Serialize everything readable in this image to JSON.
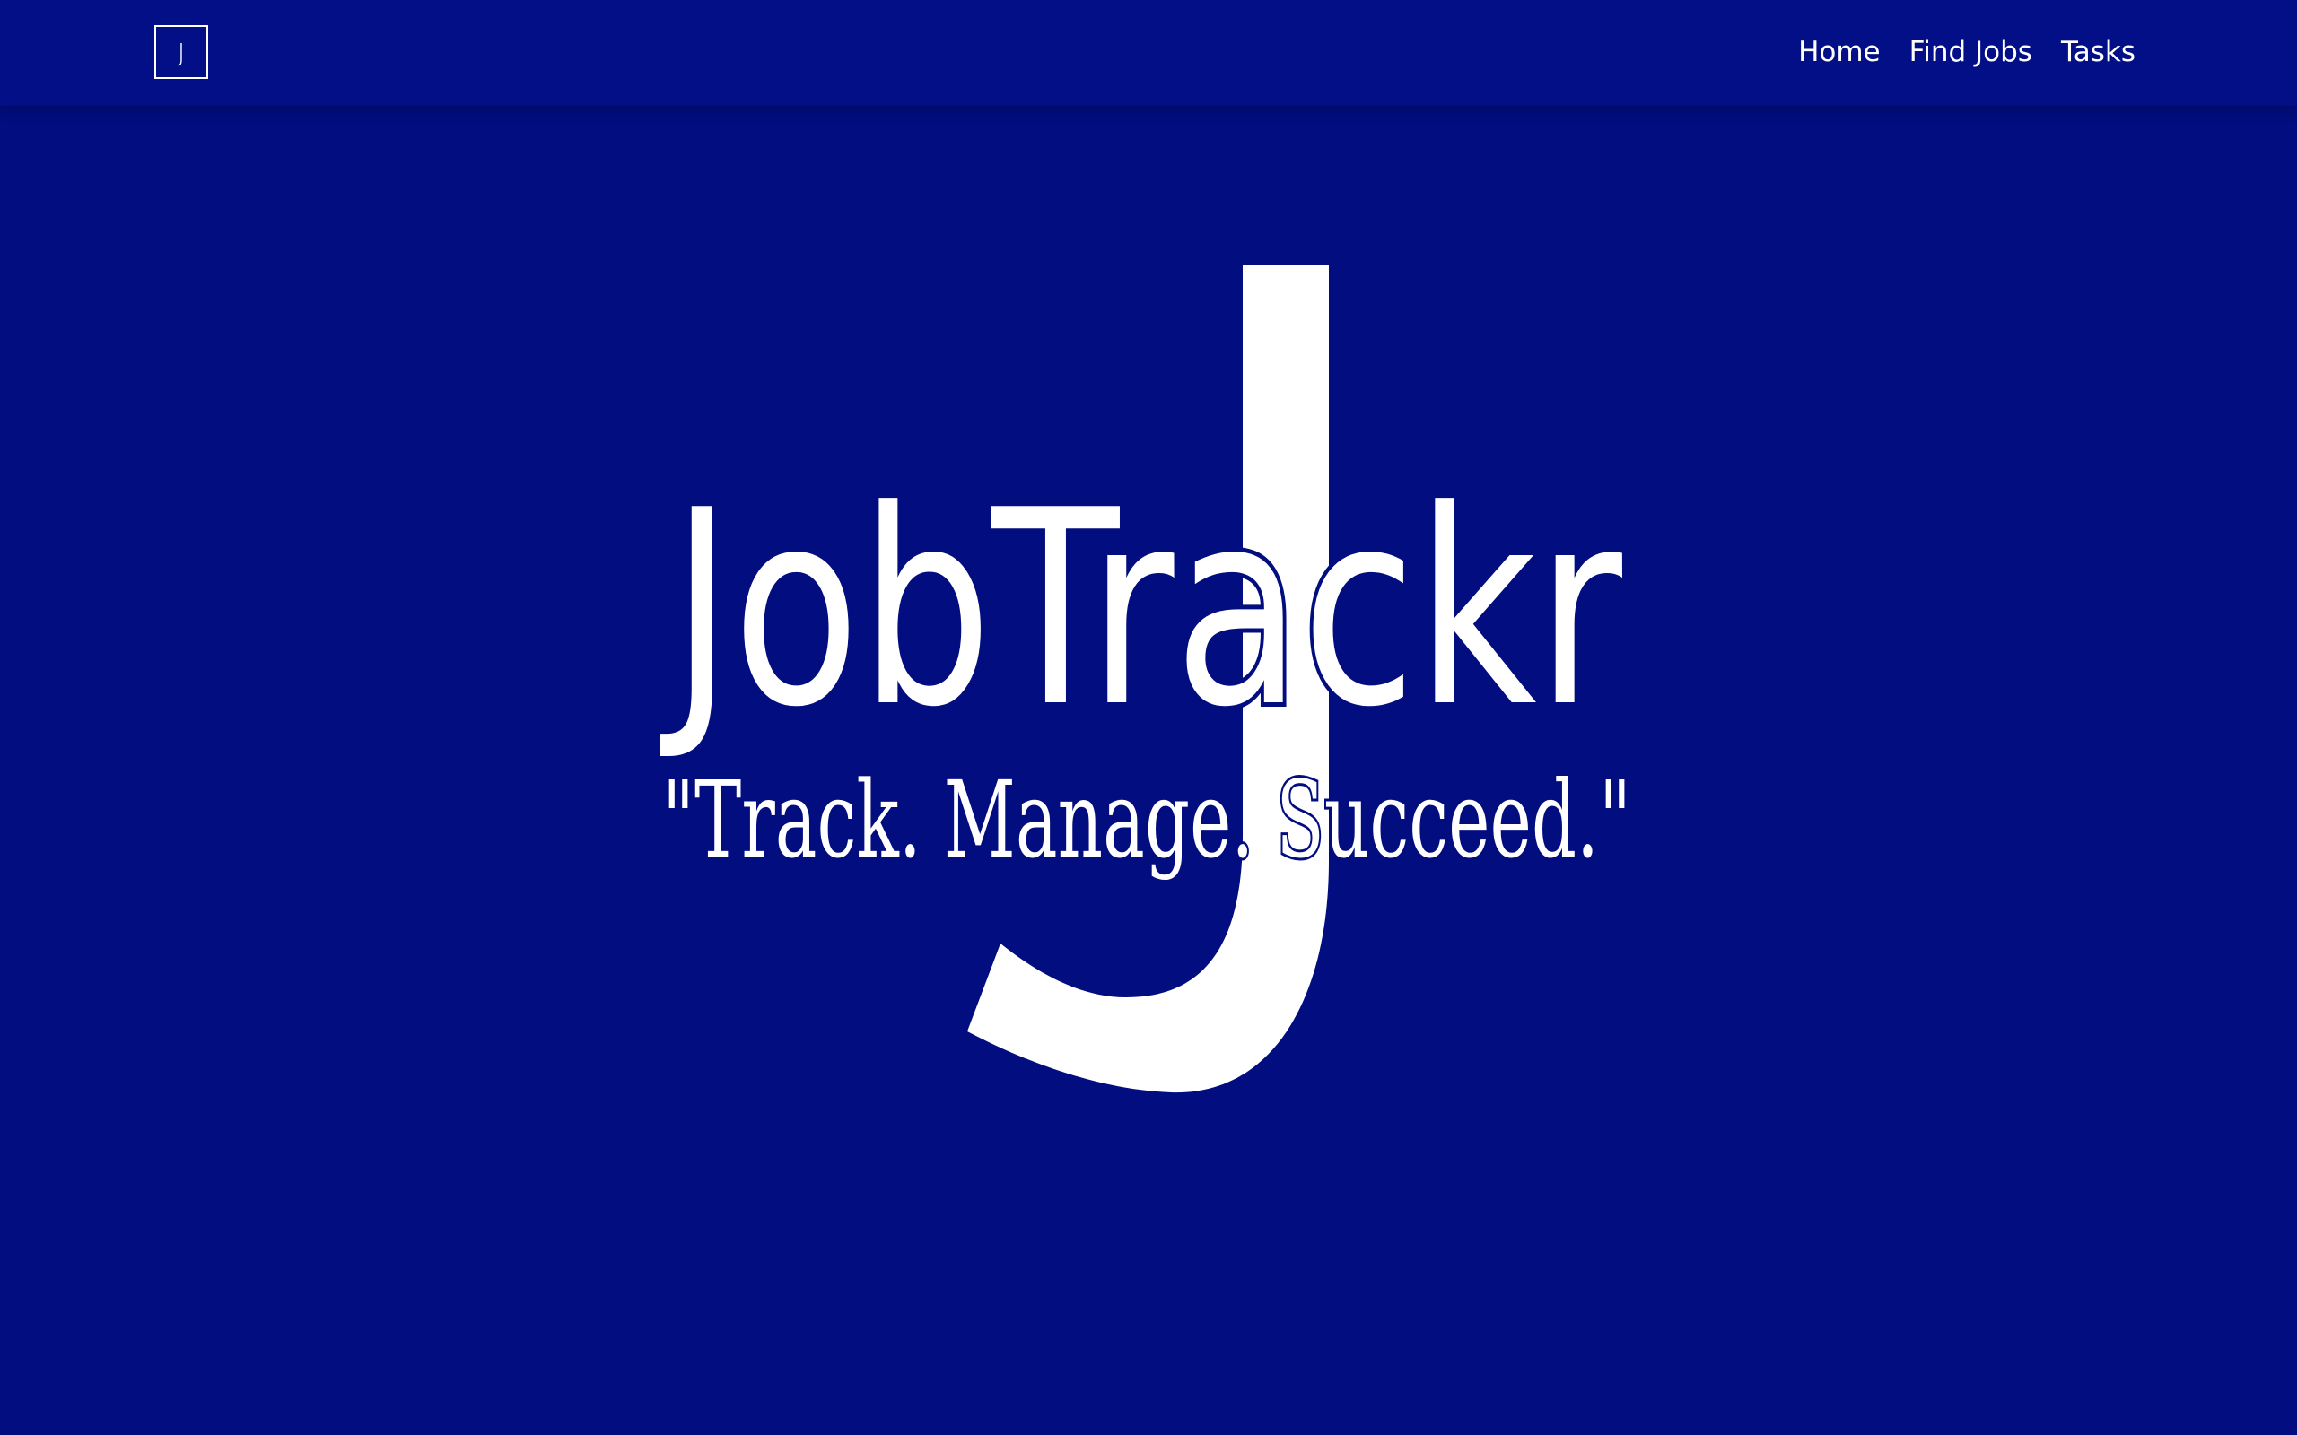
{
  "app": {
    "background_color": "#020d7f",
    "navbar_color": "#030f86",
    "text_color": "#ffffff"
  },
  "navbar": {
    "brand_letter": "J",
    "links": [
      {
        "label": "Home"
      },
      {
        "label": "Find Jobs"
      },
      {
        "label": "Tasks"
      }
    ]
  },
  "hero": {
    "watermark_letter": "J",
    "title": "JobTrackr",
    "tagline": "\"Track. Manage. Succeed.\""
  }
}
